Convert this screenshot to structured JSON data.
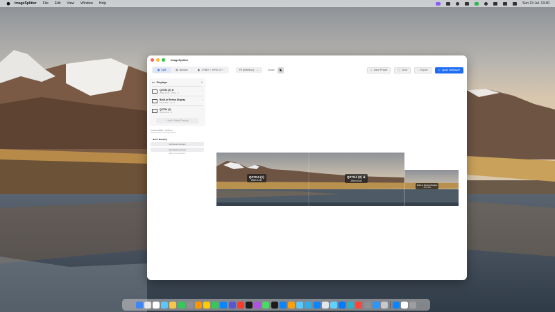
{
  "menubar": {
    "app_name": "ImageSplitter",
    "items": [
      "File",
      "Edit",
      "View",
      "Window",
      "Help"
    ],
    "clock": "Sun 13 Jul.  13:40"
  },
  "window": {
    "title": "ImageSplitter",
    "toolbar": {
      "tabs": [
        {
          "label": "Split",
          "active": true
        },
        {
          "label": "Browse",
          "active": false
        },
        {
          "label": "1 RBG + 1PHG /3 +",
          "active": false
        }
      ],
      "fit_select": "Fit (letterbox)",
      "zoom_label": "Zoom:",
      "save_preset": "Save Preset",
      "clear": "Clear",
      "export": "Export",
      "apply": "Apply Wallpaper"
    },
    "sidebar": {
      "displays_title": "Displays",
      "displays": [
        {
          "name": "Q27G4 (2) ★",
          "sub": "2560×1440  ·  100%  ·  0"
        },
        {
          "name": "Built-in Retina Display",
          "sub": "1512×982  ·  2x  ·  0"
        },
        {
          "name": "Q27G4 (1)",
          "sub": "2560×1440  ·  0"
        }
      ],
      "add_virtual": "Add Virtual Display",
      "canvas_size": "Canvas 6080 × 1440 px",
      "canvas_hint": "Drag displays to arrange layout",
      "bezel_title": "Bezel Mapping",
      "bezel_options": [
        "Add bezel numbers",
        "Auto-detect screens"
      ],
      "bezel_hint": "Bezel compensation"
    },
    "canvas": {
      "labels": [
        {
          "name": "Q27G4 (1)",
          "res": "2560×1440"
        },
        {
          "name": "Q27G4 (2) ★",
          "res": "2560×1440"
        },
        {
          "name": "Built-in Retina Display",
          "res": "1512×982"
        }
      ]
    }
  },
  "dock": {
    "icon_colors": [
      "#3d86f5",
      "#e8e8e8",
      "#ffffff",
      "#5ac8fa",
      "#f6c744",
      "#34c759",
      "#8e8e93",
      "#ff9500",
      "#ffcc00",
      "#34c759",
      "#0a84ff",
      "#5856d6",
      "#ff3b30",
      "#1c1c1e",
      "#af52de",
      "#4cd964",
      "#1c1c1e",
      "#0a84ff",
      "#ff9f0a",
      "#5ac8fa",
      "#32ade6",
      "#0a84ff",
      "#e5e5ea",
      "#64d2ff",
      "#007aff",
      "#30b0c7",
      "#ff453a",
      "#8e8e93",
      "#2997ff",
      "#c7c7cc",
      "#0a84ff",
      "#ffffff",
      "#9e9e9e"
    ],
    "separator_after": 30
  }
}
